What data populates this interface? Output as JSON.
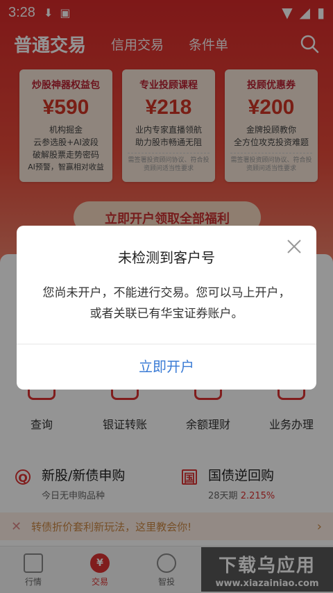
{
  "status_bar": {
    "time": "3:28"
  },
  "header": {
    "tabs": [
      {
        "label": "普通交易",
        "active": true
      },
      {
        "label": "信用交易",
        "active": false
      },
      {
        "label": "条件单",
        "active": false
      }
    ]
  },
  "promo_cards": [
    {
      "title": "炒股神器权益包",
      "price": "¥590",
      "desc": [
        "机构掘金",
        "云参选股+AI波段",
        "破解股票走势密码",
        "AI预警，智赢相对收益"
      ],
      "note": ""
    },
    {
      "title": "专业投顾课程",
      "price": "¥218",
      "desc": [
        "业内专家直播领航",
        "助力股市畅通无阻"
      ],
      "note": "需签署投资顾问协议、符合投资顾问适当性要求"
    },
    {
      "title": "投顾优惠券",
      "price": "¥200",
      "desc": [
        "金牌投顾教你",
        "全方位攻克投资难题"
      ],
      "note": "需签署投资顾问协议、符合投资顾问适当性要求"
    }
  ],
  "cta": {
    "label": "立即开户领取全部福利"
  },
  "quick_actions": [
    "查询",
    "银证转账",
    "余额理财",
    "业务办理"
  ],
  "features": [
    {
      "title": "新股/新债申购",
      "sub": "今日无申购品种",
      "sub_red": ""
    },
    {
      "title": "国债逆回购",
      "sub": "28天期",
      "sub_red": "2.215%"
    }
  ],
  "banner": {
    "text": "转债折价套利新玩法，这里教会你!"
  },
  "bottom_nav": [
    {
      "label": "行情",
      "active": false
    },
    {
      "label": "交易",
      "active": true,
      "glyph": "¥"
    },
    {
      "label": "智投",
      "active": false
    },
    {
      "label": "",
      "active": false
    },
    {
      "label": "",
      "active": false
    }
  ],
  "watermark": {
    "line1": "下载乌应用",
    "line2": "www.xiazainiao.com"
  },
  "dialog": {
    "title": "未检测到客户号",
    "message": "您尚未开户，不能进行交易。您可以马上开户，或者关联已有华宝证券账户。",
    "action": "立即开户"
  },
  "colors": {
    "brand_red": "#d92a2a",
    "link_blue": "#3a7bd5"
  }
}
